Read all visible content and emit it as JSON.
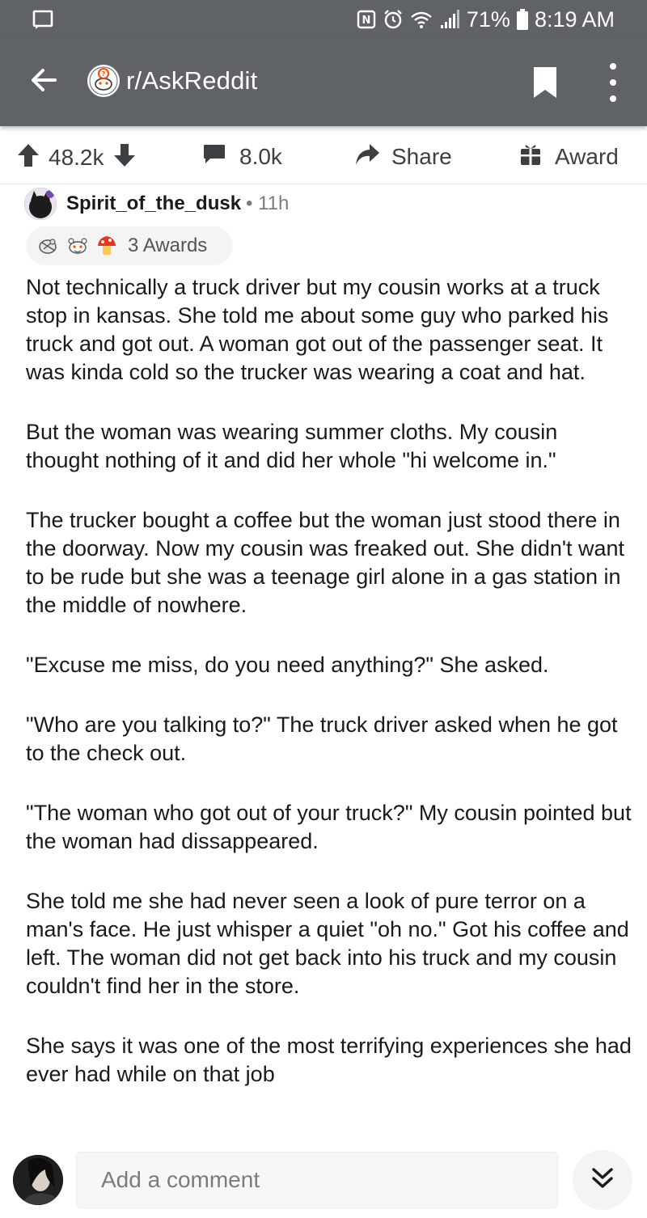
{
  "status_bar": {
    "battery_percent": "71%",
    "time": "8:19 AM",
    "icons": [
      "notification-icon",
      "nfc-icon",
      "alarm-icon",
      "wifi-icon",
      "signal-icon",
      "battery-icon"
    ]
  },
  "app_bar": {
    "title": "r/AskReddit",
    "icons": [
      "back-arrow-icon",
      "subreddit-avatar-icon",
      "bookmark-icon",
      "more-vertical-icon"
    ]
  },
  "actions": {
    "score": "48.2k",
    "comments": "8.0k",
    "share": "Share",
    "award": "Award"
  },
  "comment": {
    "author": "Spirit_of_the_dusk",
    "separator": "•",
    "age": "11h",
    "awards_label": "3 Awards",
    "award_icons": [
      "wholesome-seal-icon",
      "helpful-snoo-icon",
      "silver-award-icon"
    ],
    "paragraphs": [
      "Not technically a truck driver but my cousin works at a truck stop in kansas. She told me about some guy who parked his truck and got out. A woman got out of the passenger seat. It was kinda cold so the trucker was wearing a coat and hat.",
      "But the woman was wearing summer cloths. My cousin thought nothing of it and did her whole \"hi welcome in.\"",
      "The trucker bought a coffee but the woman just stood there in the doorway. Now my cousin was freaked out. She didn't want to be rude but she was a teenage girl alone in a gas station in the middle of nowhere.",
      "\"Excuse me miss, do you need anything?\" She asked.",
      "\"Who are you talking to?\" The truck driver asked when he got to the check out.",
      "\"The woman who got out of your truck?\" My cousin pointed but the woman had dissappeared.",
      "She told me she had never seen a look of pure terror on a man's face. He just whisper a quiet \"oh no.\" Got his coffee and left. The woman did not get back into his truck and my cousin couldn't find her in the store.",
      "She says it was one of the most terrifying experiences she had ever had while on that job"
    ]
  },
  "composer": {
    "placeholder": "Add a comment"
  },
  "colors": {
    "header_bg": "#5f6368",
    "text_primary": "#1a1a1b",
    "text_muted": "#7c7c7c",
    "action_gray": "#3c4043"
  }
}
